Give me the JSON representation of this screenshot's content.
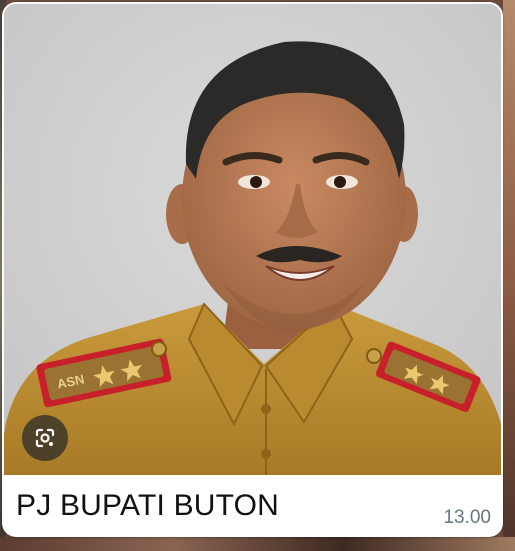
{
  "message": {
    "caption": "PJ BUPATI BUTON",
    "time": "13.00",
    "image_alt": "Portrait photo of a man in a khaki civil-service uniform"
  },
  "icons": {
    "lens": "google-lens-icon"
  },
  "colors": {
    "bubble": "#ffffff",
    "photo_background": "#d2d2d2",
    "uniform": "#b8892f",
    "epaulette_red": "#c8202a",
    "time_text": "#667781"
  }
}
